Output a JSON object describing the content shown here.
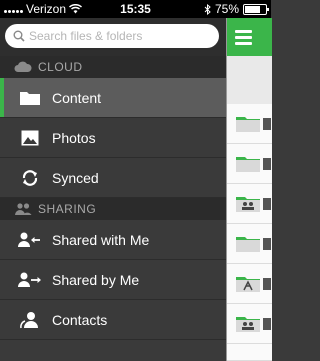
{
  "status_bar": {
    "carrier": "Verizon",
    "time": "15:35",
    "battery": "75%"
  },
  "search": {
    "placeholder": "Search files & folders"
  },
  "sidebar": {
    "sections": [
      {
        "header": "CLOUD",
        "header_icon": "cloud-icon",
        "items": [
          {
            "label": "Content",
            "icon": "folder-icon",
            "active": true
          },
          {
            "label": "Photos",
            "icon": "photo-icon",
            "active": false
          },
          {
            "label": "Synced",
            "icon": "sync-icon",
            "active": false
          }
        ]
      },
      {
        "header": "SHARING",
        "header_icon": "people-icon",
        "items": [
          {
            "label": "Shared with Me",
            "icon": "shared-with-me-icon",
            "active": false
          },
          {
            "label": "Shared by Me",
            "icon": "shared-by-me-icon",
            "active": false
          },
          {
            "label": "Contacts",
            "icon": "contacts-icon",
            "active": false
          }
        ]
      }
    ]
  },
  "colors": {
    "accent": "#3bb54a",
    "sidebar_bg": "#3a3a3a",
    "active_item_bg": "#5c5c5c",
    "section_header_bg": "#2b2b2b"
  },
  "content_pane": {
    "rows": [
      {
        "icon": "folder-icon"
      },
      {
        "icon": "folder-icon"
      },
      {
        "icon": "shared-folder-icon"
      },
      {
        "icon": "folder-icon"
      },
      {
        "icon": "linked-folder-icon"
      },
      {
        "icon": "shared-folder-icon"
      }
    ]
  }
}
